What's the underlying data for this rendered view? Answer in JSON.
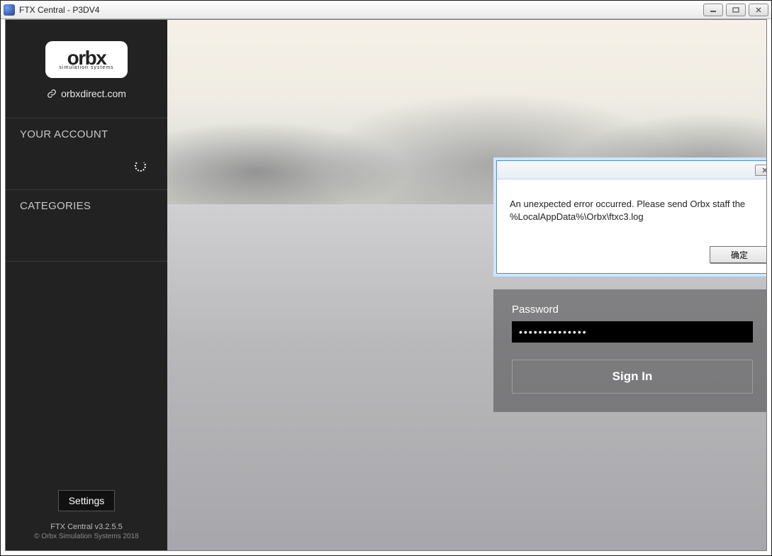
{
  "window": {
    "title": "FTX Central - P3DV4"
  },
  "sidebar": {
    "logo_main": "orbx",
    "logo_sub": "simulation systems",
    "link_text": "orbxdirect.com",
    "account_header": "YOUR ACCOUNT",
    "categories_header": "CATEGORIES",
    "settings_label": "Settings",
    "version_text": "FTX Central v3.2.5.5",
    "copyright_text": "© Orbx Simulation Systems 2018"
  },
  "login": {
    "password_label": "Password",
    "password_value": "••••••••••••••",
    "signin_label": "Sign In"
  },
  "dialog": {
    "message": "An unexpected error occurred. Please send Orbx staff the %LocalAppData%\\Orbx\\ftxc3.log",
    "ok_label": "确定"
  }
}
